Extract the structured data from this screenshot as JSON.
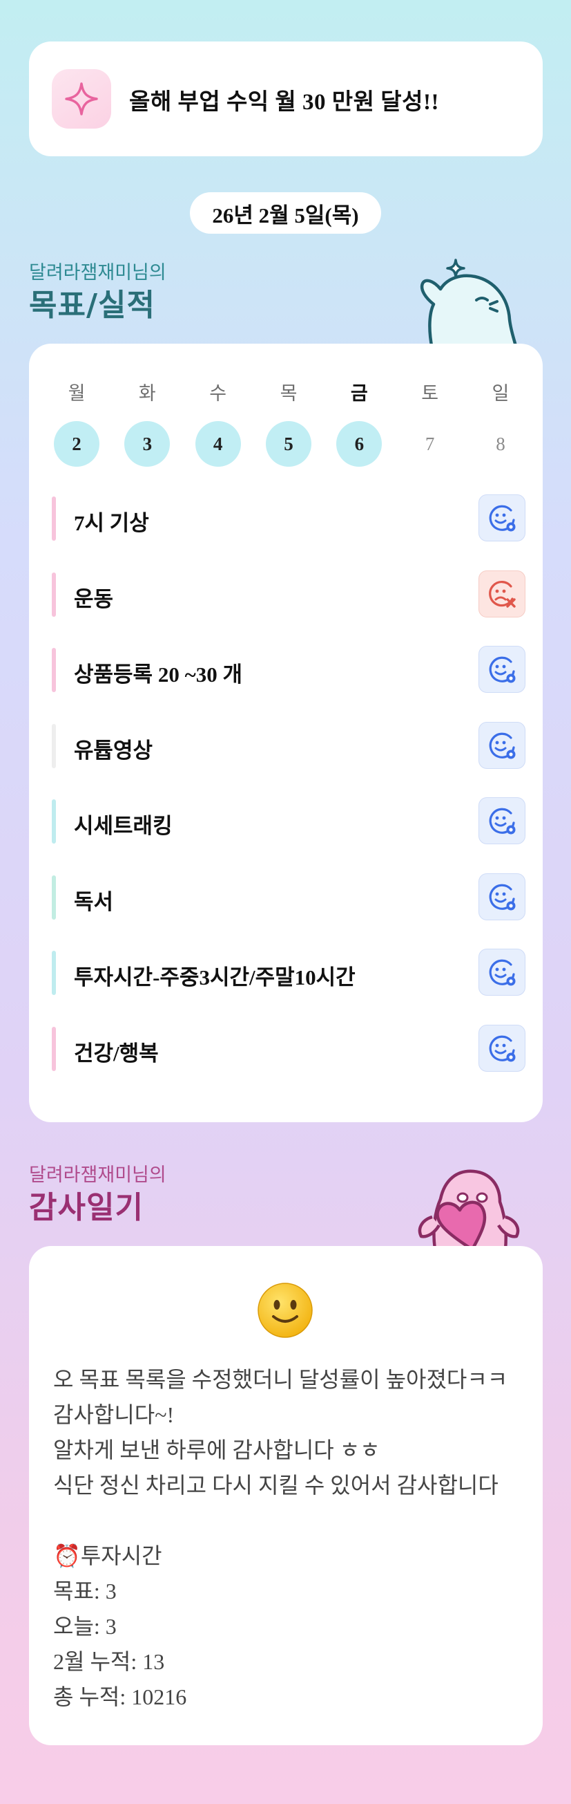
{
  "goal_banner": {
    "text": "올해 부업 수익 월 30 만원 달성!!"
  },
  "date": "26년 2월 5일(목)",
  "goals_section": {
    "subtitle": "달려라잼재미님의",
    "title": "목표/실적"
  },
  "week": [
    {
      "name": "월",
      "num": "2",
      "active": true,
      "today": false
    },
    {
      "name": "화",
      "num": "3",
      "active": true,
      "today": false
    },
    {
      "name": "수",
      "num": "4",
      "active": true,
      "today": false
    },
    {
      "name": "목",
      "num": "5",
      "active": true,
      "today": false
    },
    {
      "name": "금",
      "num": "6",
      "active": true,
      "today": true
    },
    {
      "name": "토",
      "num": "7",
      "active": false,
      "today": false
    },
    {
      "name": "일",
      "num": "8",
      "active": false,
      "today": false
    }
  ],
  "goals": [
    {
      "label": "7시 기상",
      "status": "done",
      "bar_color": "#f7c4dc"
    },
    {
      "label": "운동",
      "status": "failed",
      "bar_color": "#f7c4dc"
    },
    {
      "label": "상품등록 20 ~30 개",
      "status": "done",
      "bar_color": "#f7c4dc"
    },
    {
      "label": "유튭영상",
      "status": "done",
      "bar_color": "#eeeeee"
    },
    {
      "label": "시세트래킹",
      "status": "done",
      "bar_color": "#bfecef"
    },
    {
      "label": "독서",
      "status": "done",
      "bar_color": "#c2ede2"
    },
    {
      "label": "투자시간-주중3시간/주말10시간",
      "status": "done",
      "bar_color": "#bfecef"
    },
    {
      "label": "건강/행복",
      "status": "done",
      "bar_color": "#f7c4dc"
    }
  ],
  "diary_section": {
    "subtitle": "달려라잼재미님의",
    "title": "감사일기"
  },
  "diary": {
    "mood_icon": "slightly-smiling-face",
    "lines": [
      "오 목표 목록을 수정했더니 달성률이 높아졌다ㅋㅋ",
      "감사합니다~!",
      "알차게 보낸 하루에 감사합니다 ㅎㅎ",
      "식단 정신 차리고 다시 지킬 수 있어서 감사합니다",
      "",
      "⏰투자시간",
      "목표: 3",
      "오늘: 3",
      "2월 누적: 13",
      "총 누적: 10216"
    ]
  },
  "colors": {
    "goals_subtitle": "#2e8a92",
    "goals_title": "#2a6f78",
    "diary_subtitle": "#b04b8c",
    "diary_title": "#9a3072",
    "status_ok": "#3b6ee8",
    "status_fail": "#e0574b"
  }
}
